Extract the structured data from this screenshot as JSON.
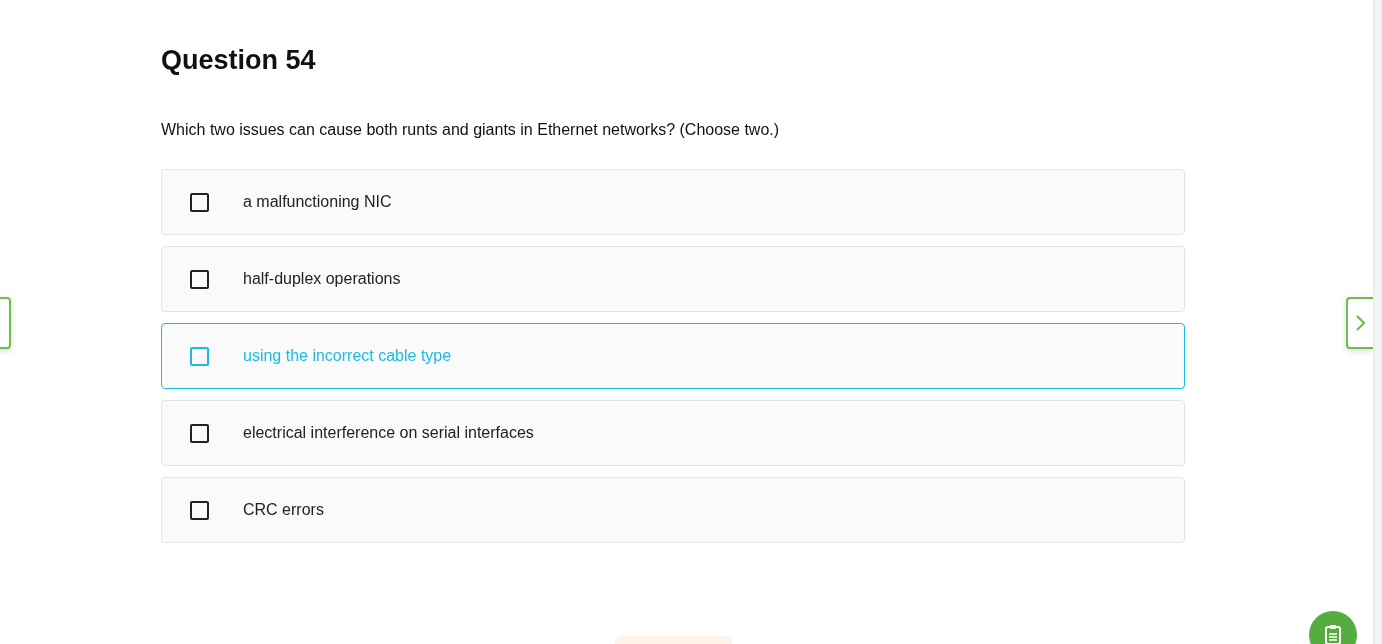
{
  "question": {
    "title": "Question 54",
    "text": "Which two issues can cause both runts and giants in Ethernet networks? (Choose two.)"
  },
  "options": [
    {
      "label": "a malfunctioning NIC",
      "checked": false,
      "highlighted": false
    },
    {
      "label": "half-duplex operations",
      "checked": false,
      "highlighted": false
    },
    {
      "label": "using the incorrect cable type",
      "checked": false,
      "highlighted": true
    },
    {
      "label": "electrical interference on serial interfaces",
      "checked": false,
      "highlighted": false
    },
    {
      "label": "CRC errors",
      "checked": false,
      "highlighted": false
    }
  ]
}
